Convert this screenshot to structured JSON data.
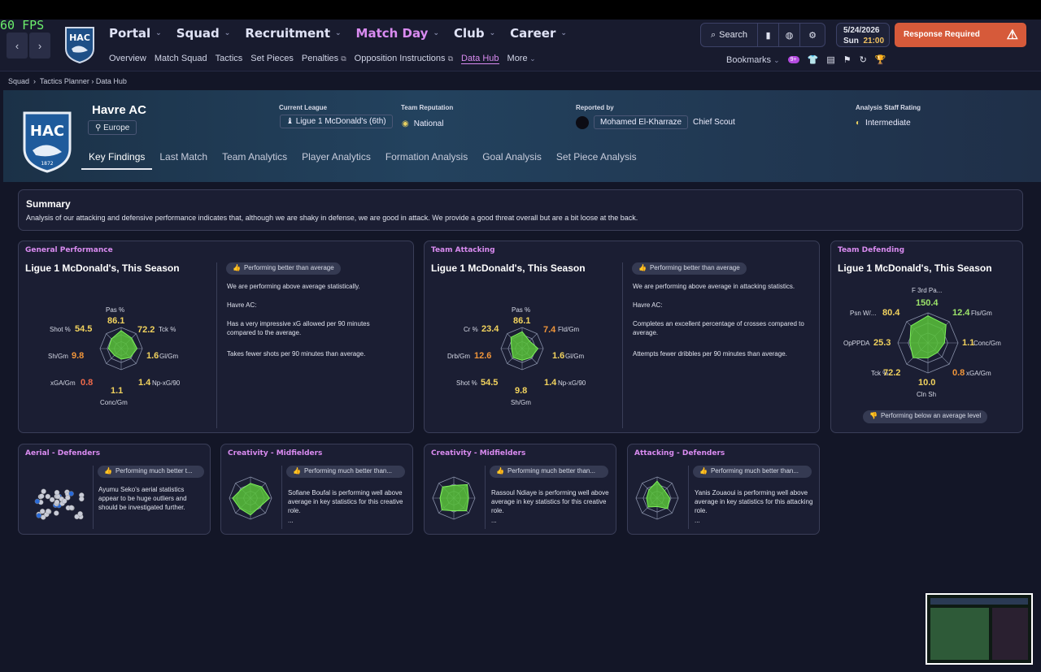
{
  "fps": "60 FPS",
  "nav": {
    "items": [
      "Portal",
      "Squad",
      "Recruitment",
      "Match Day",
      "Club",
      "Career"
    ],
    "sub": [
      "Overview",
      "Match Squad",
      "Tactics",
      "Set Pieces",
      "Penalties",
      "Opposition Instructions",
      "Data Hub",
      "More"
    ],
    "search": "Search",
    "date": "5/24/2026",
    "day": "Sun",
    "time": "21:00",
    "response": "Response Required",
    "bookmarks": "Bookmarks",
    "badge": "9+"
  },
  "breadcrumb": [
    "Squad",
    "Tactics Planner",
    "Data Hub"
  ],
  "team": {
    "name": "Havre AC",
    "region": "Europe",
    "logo_text": "HAC",
    "logo_year": "1872",
    "league_label": "Current League",
    "league": "Ligue 1 McDonald's (6th)",
    "rep_label": "Team Reputation",
    "rep": "National",
    "rep_by_label": "Reported by",
    "scout": "Mohamed El-Kharraze",
    "scout_role": "Chief Scout",
    "rating_label": "Analysis Staff Rating",
    "rating": "Intermediate"
  },
  "tabs": [
    "Key Findings",
    "Last Match",
    "Team Analytics",
    "Player Analytics",
    "Formation Analysis",
    "Goal Analysis",
    "Set Piece Analysis"
  ],
  "summary": {
    "title": "Summary",
    "text": "Analysis of our attacking and defensive performance indicates that, although we are shaky in defense, we are good in attack. We provide a good threat overall but are a bit loose at the back."
  },
  "cards": {
    "general": {
      "title": "General Performance",
      "sub": "Ligue 1 McDonald's, This Season",
      "pill": "Performing better than average",
      "p1": "We are performing above average statistically.",
      "p2": "Havre AC:",
      "p3": "Has a very impressive xG allowed per 90 minutes compared to the average.",
      "p4": "Takes fewer shots per 90 minutes than average.",
      "stats": [
        {
          "label": "Pas %",
          "value": "86.1"
        },
        {
          "label": "Tck %",
          "value": "72.2"
        },
        {
          "label": "Gl/Gm",
          "value": "1.6"
        },
        {
          "label": "Np-xG/90",
          "value": "1.4"
        },
        {
          "label": "Conc/Gm",
          "value": "1.1"
        },
        {
          "label": "xGA/Gm",
          "value": "0.8"
        },
        {
          "label": "Sh/Gm",
          "value": "9.8"
        },
        {
          "label": "Shot %",
          "value": "54.5"
        }
      ]
    },
    "attacking": {
      "title": "Team Attacking",
      "sub": "Ligue 1 McDonald's, This Season",
      "pill": "Performing better than average",
      "p1": "We are performing above average in attacking statistics.",
      "p2": "Havre AC:",
      "p3": "Completes an excellent percentage of crosses compared to average.",
      "p4": "Attempts fewer dribbles per 90 minutes than average.",
      "stats": [
        {
          "label": "Pas %",
          "value": "86.1"
        },
        {
          "label": "Fld/Gm",
          "value": "7.4"
        },
        {
          "label": "Gl/Gm",
          "value": "1.6"
        },
        {
          "label": "Np-xG/90",
          "value": "1.4"
        },
        {
          "label": "Sh/Gm",
          "value": "9.8"
        },
        {
          "label": "Shot %",
          "value": "54.5"
        },
        {
          "label": "Drb/Gm",
          "value": "12.6"
        },
        {
          "label": "Cr %",
          "value": "23.4"
        }
      ]
    },
    "defending": {
      "title": "Team Defending",
      "sub": "Ligue 1 McDonald's, This Season",
      "pill": "Performing below an average level",
      "stats": [
        {
          "label": "F 3rd Pa...",
          "value": "150.4"
        },
        {
          "label": "Fls/Gm",
          "value": "12.4"
        },
        {
          "label": "Conc/Gm",
          "value": "1.1"
        },
        {
          "label": "xGA/Gm",
          "value": "0.8"
        },
        {
          "label": "Cln Sh",
          "value": "10.0"
        },
        {
          "label": "Tck %",
          "value": "72.2"
        },
        {
          "label": "OpPPDA",
          "value": "25.3"
        },
        {
          "label": "Psn W/...",
          "value": "80.4"
        }
      ]
    },
    "small": [
      {
        "title": "Aerial - Defenders",
        "pill": "Performing much better t...",
        "text": "Ayumu Seko's aerial statistics appear to be huge outliers and should be investigated further."
      },
      {
        "title": "Creativity - Midfielders",
        "pill": "Performing much better than...",
        "text": "Sofiane Boufal is performing well above average in key statistics for this creative role.",
        "more": "..."
      },
      {
        "title": "Creativity - Midfielders",
        "pill": "Performing much better than...",
        "text": "Rassoul Ndiaye is performing well above average in key statistics for this creative role.",
        "more": "..."
      },
      {
        "title": "Attacking - Defenders",
        "pill": "Performing much better than...",
        "text": "Yanis Zouaoui is performing well above average in key statistics for this attacking role.",
        "more": "..."
      }
    ]
  },
  "colors": {
    "accent": "#d98bf0",
    "radar": "#58c23a",
    "response": "#d65a3a"
  }
}
